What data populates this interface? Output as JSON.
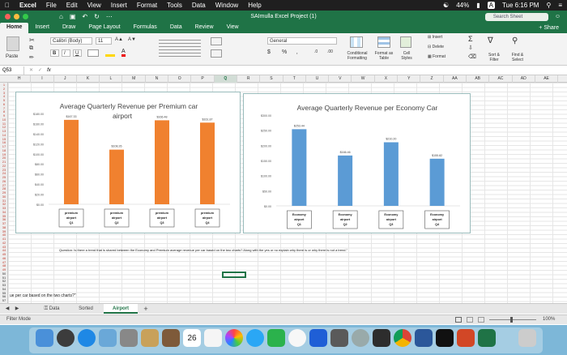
{
  "menubar": {
    "app": "Excel",
    "items": [
      "File",
      "Edit",
      "View",
      "Insert",
      "Format",
      "Tools",
      "Data",
      "Window",
      "Help"
    ],
    "battery": "44%",
    "clock": "Tue 6:16 PM"
  },
  "window": {
    "title": "SAImulla Excel Project (1)",
    "search_placeholder": "Search Sheet"
  },
  "ribbon_tabs": [
    "Home",
    "Insert",
    "Draw",
    "Page Layout",
    "Formulas",
    "Data",
    "Review",
    "View"
  ],
  "share_label": "Share",
  "ribbon": {
    "paste": "Paste",
    "font_name": "Calibri (Body)",
    "font_size": "11",
    "number_format": "General",
    "bold": "B",
    "italic": "I",
    "underline": "U",
    "cond_format": "Conditional Formatting",
    "format_table": "Format as Table",
    "cell_styles": "Cell Styles",
    "insert": "Insert",
    "delete": "Delete",
    "format": "Format",
    "sort_filter": "Sort & Filter",
    "find_select": "Find & Select"
  },
  "formula_bar": {
    "cell": "Q53",
    "fx": "fx",
    "value": ""
  },
  "columns": [
    "H",
    "I",
    "J",
    "K",
    "L",
    "M",
    "N",
    "O",
    "P",
    "Q",
    "R",
    "S",
    "T",
    "U",
    "V",
    "W",
    "X",
    "Y",
    "Z",
    "AA",
    "AB",
    "AC",
    "AD",
    "AE"
  ],
  "selected_column": "Q",
  "rows": [
    "1",
    "2",
    "3",
    "4",
    "5",
    "6",
    "7",
    "8",
    "9",
    "10",
    "11",
    "12",
    "13",
    "14",
    "15",
    "16",
    "17",
    "18",
    "19",
    "20",
    "21",
    "22",
    "23",
    "24",
    "25",
    "26",
    "27",
    "28",
    "29",
    "30",
    "31",
    "32",
    "33",
    "34",
    "35",
    "36",
    "37",
    "38",
    "39",
    "40",
    "41",
    "42",
    "43",
    "44",
    "45",
    "46",
    "47",
    "48",
    "49",
    "50",
    "51",
    "52",
    "53",
    "54",
    "55",
    "56",
    "57"
  ],
  "charts": [
    {
      "title": "Average Quarterly Revenue per Premium car airport",
      "title_line1": "Average Quarterly Revenue per Premium car",
      "title_line2": "airport",
      "color": "#f0812f",
      "yticks": [
        "$180.00",
        "$160.00",
        "$140.00",
        "$120.00",
        "$100.00",
        "$80.00",
        "$60.00",
        "$40.00",
        "$20.00",
        "$0.00"
      ],
      "categories": [
        [
          "premium",
          "airport",
          "Q1"
        ],
        [
          "premium",
          "airport",
          "Q2"
        ],
        [
          "premium",
          "airport",
          "Q3"
        ],
        [
          "premium",
          "airport",
          "Q4"
        ]
      ],
      "values": [
        167.33,
        108.26,
        166.48,
        161.87
      ],
      "labels": [
        "$167.33",
        "$108.26",
        "$166.48",
        "$161.87"
      ]
    },
    {
      "title": "Average Quarterly Revenue per Economy Car",
      "color": "#5b9bd5",
      "yticks": [
        "$300.00",
        "$250.00",
        "$200.00",
        "$150.00",
        "$100.00",
        "$50.00",
        "$0.00"
      ],
      "categories": [
        [
          "Economy",
          "airport",
          "Q1"
        ],
        [
          "Economy",
          "airport",
          "Q2"
        ],
        [
          "Economy",
          "airport",
          "Q3"
        ],
        [
          "Economy",
          "airport",
          "Q4"
        ]
      ],
      "values": [
        253.44,
        166.46,
        210.2,
        155.82
      ],
      "labels": [
        "$253.44",
        "$166.46",
        "$210.20",
        "$155.82"
      ]
    }
  ],
  "chart_data": [
    {
      "type": "bar",
      "title": "Average Quarterly Revenue per Premium car airport",
      "categories": [
        "premium airport Q1",
        "premium airport Q2",
        "premium airport Q3",
        "premium airport Q4"
      ],
      "values": [
        167.33,
        108.26,
        166.48,
        161.87
      ],
      "ylim": [
        0,
        180
      ],
      "xlabel": "",
      "ylabel": "",
      "grid": false
    },
    {
      "type": "bar",
      "title": "Average Quarterly Revenue per Economy Car",
      "categories": [
        "Economy airport Q1",
        "Economy airport Q2",
        "Economy airport Q3",
        "Economy airport Q4"
      ],
      "values": [
        253.44,
        166.46,
        210.2,
        155.82
      ],
      "ylim": [
        0,
        300
      ],
      "xlabel": "",
      "ylabel": "",
      "grid": false
    }
  ],
  "question_text": "Question: Is there a trend that is shared between the Economy and Premium average revenue per car based on the two charts? Along with the yes or no explain why there is or why there is not a trend.\"",
  "leftover_text": "ue per car based on the two charts?\"",
  "sheet_tabs": [
    "Data",
    "Sorted",
    "Airport"
  ],
  "active_sheet": "Airport",
  "status": {
    "mode": "Filter Mode",
    "zoom": "100%"
  },
  "dock": {
    "calendar_day": "26"
  }
}
